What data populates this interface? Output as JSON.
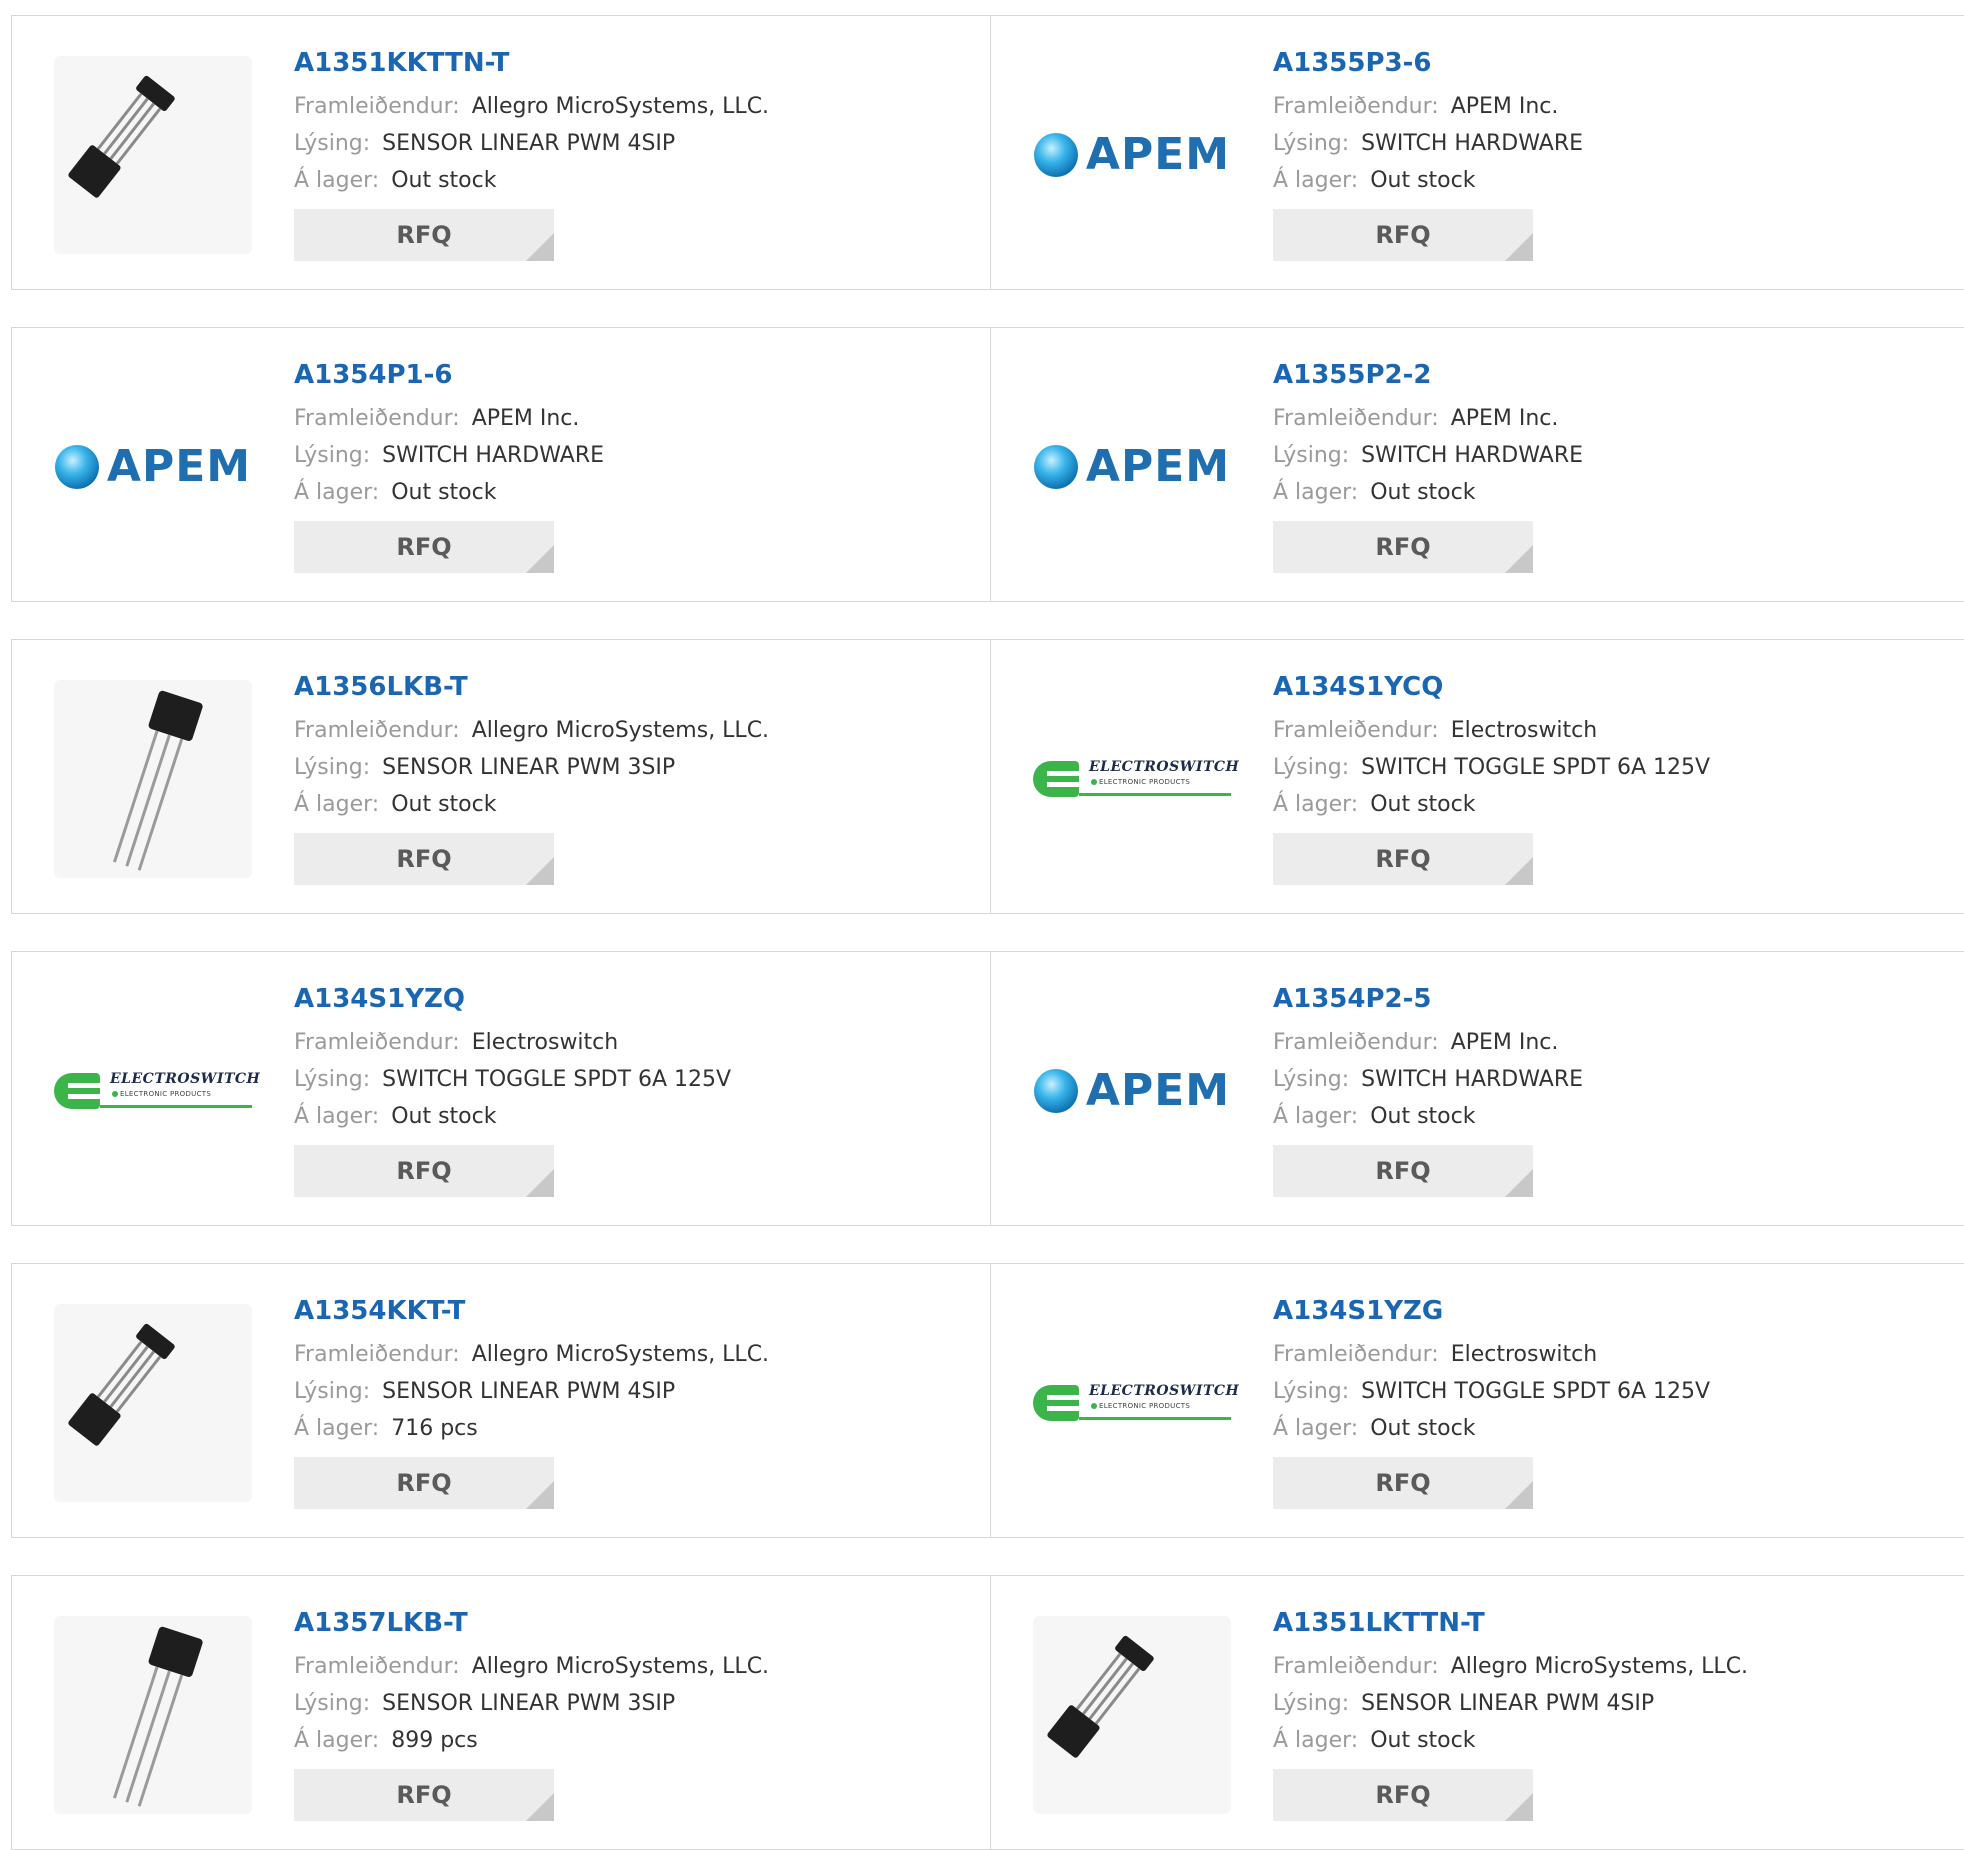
{
  "labels": {
    "manufacturer": "Framleiðendur:",
    "description": "Lýsing:",
    "stock": "Á lager:",
    "rfq": "RFQ"
  },
  "products": [
    {
      "part": "A1351KKTTN-T",
      "manufacturer": "Allegro MicroSystems, LLC.",
      "description": "SENSOR LINEAR PWM 4SIP",
      "stock": "Out stock",
      "image": "ic-4sip-package"
    },
    {
      "part": "A1355P3-6",
      "manufacturer": "APEM Inc.",
      "description": "SWITCH HARDWARE",
      "stock": "Out stock",
      "image": "apem-logo"
    },
    {
      "part": "A1354P1-6",
      "manufacturer": "APEM Inc.",
      "description": "SWITCH HARDWARE",
      "stock": "Out stock",
      "image": "apem-logo"
    },
    {
      "part": "A1355P2-2",
      "manufacturer": "APEM Inc.",
      "description": "SWITCH HARDWARE",
      "stock": "Out stock",
      "image": "apem-logo"
    },
    {
      "part": "A1356LKB-T",
      "manufacturer": "Allegro MicroSystems, LLC.",
      "description": "SENSOR LINEAR PWM 3SIP",
      "stock": "Out stock",
      "image": "ic-3sip-package"
    },
    {
      "part": "A134S1YCQ",
      "manufacturer": "Electroswitch",
      "description": "SWITCH TOGGLE SPDT 6A 125V",
      "stock": "Out stock",
      "image": "electroswitch-logo"
    },
    {
      "part": "A134S1YZQ",
      "manufacturer": "Electroswitch",
      "description": "SWITCH TOGGLE SPDT 6A 125V",
      "stock": "Out stock",
      "image": "electroswitch-logo"
    },
    {
      "part": "A1354P2-5",
      "manufacturer": "APEM Inc.",
      "description": "SWITCH HARDWARE",
      "stock": "Out stock",
      "image": "apem-logo"
    },
    {
      "part": "A1354KKT-T",
      "manufacturer": "Allegro MicroSystems, LLC.",
      "description": "SENSOR LINEAR PWM 4SIP",
      "stock": "716 pcs",
      "image": "ic-4sip-package"
    },
    {
      "part": "A134S1YZG",
      "manufacturer": "Electroswitch",
      "description": "SWITCH TOGGLE SPDT 6A 125V",
      "stock": "Out stock",
      "image": "electroswitch-logo"
    },
    {
      "part": "A1357LKB-T",
      "manufacturer": "Allegro MicroSystems, LLC.",
      "description": "SENSOR LINEAR PWM 3SIP",
      "stock": "899 pcs",
      "image": "ic-3sip-package"
    },
    {
      "part": "A1351LKTTN-T",
      "manufacturer": "Allegro MicroSystems, LLC.",
      "description": "SENSOR LINEAR PWM 4SIP",
      "stock": "Out stock",
      "image": "ic-4sip-package"
    }
  ],
  "logos": {
    "apem": "APEM",
    "electroswitch_name": "ELECTROSWITCH",
    "electroswitch_sub": "ELECTRONIC PRODUCTS"
  },
  "colors": {
    "part_link": "#1a66b3",
    "label": "#9a9a9a",
    "value": "#333333",
    "rfq_bg": "#ececec",
    "border": "#d6d6d6",
    "electroswitch_green": "#3bb54a",
    "apem_blue": "#1f6fb0"
  }
}
